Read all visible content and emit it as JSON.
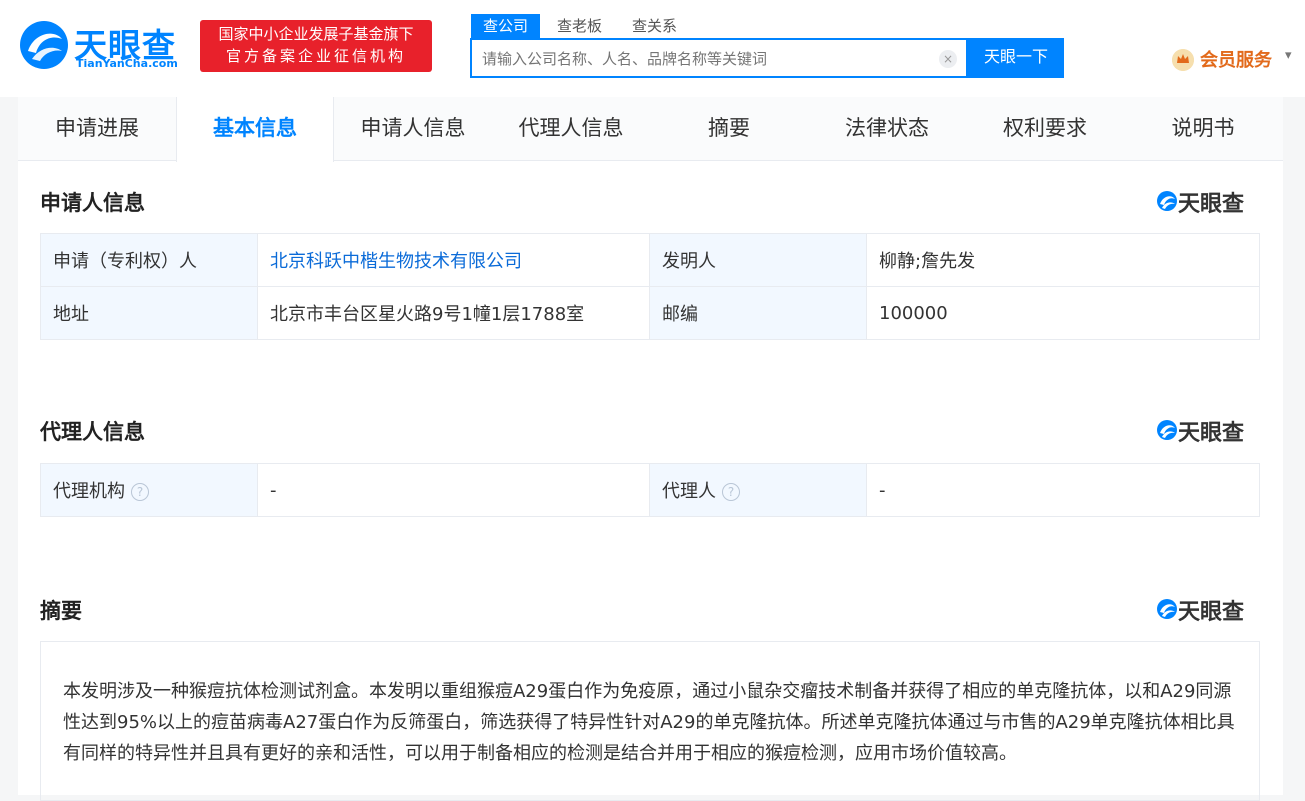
{
  "header": {
    "logo_text": "天眼查",
    "logo_sub": "TianYanCha.com",
    "badge_line1": "国家中小企业发展子基金旗下",
    "badge_line2": "官方备案企业征信机构",
    "search_tabs": [
      "查公司",
      "查老板",
      "查关系"
    ],
    "search_placeholder": "请输入公司名称、人名、品牌名称等关键词",
    "search_clear": "×",
    "search_button": "天眼一下",
    "member_label": "会员服务",
    "member_caret": "▾"
  },
  "tabs": [
    "申请进展",
    "基本信息",
    "申请人信息",
    "代理人信息",
    "摘要",
    "法律状态",
    "权利要求",
    "说明书"
  ],
  "active_tab": "基本信息",
  "watermark": "天眼查",
  "applicant_section": {
    "title": "申请人信息",
    "rows": [
      {
        "label1": "申请（专利权）人",
        "value1": "北京科跃中楷生物技术有限公司",
        "label2": "发明人",
        "value2": "柳静;詹先发"
      },
      {
        "label1": "地址",
        "value1": "北京市丰台区星火路9号1幢1层1788室",
        "label2": "邮编",
        "value2": "100000"
      }
    ]
  },
  "agent_section": {
    "title": "代理人信息",
    "label1": "代理机构",
    "value1": "-",
    "label2": "代理人",
    "value2": "-",
    "help_glyph": "?"
  },
  "abstract_section": {
    "title": "摘要",
    "text": "本发明涉及一种猴痘抗体检测试剂盒。本发明以重组猴痘A29蛋白作为免疫原，通过小鼠杂交瘤技术制备并获得了相应的单克隆抗体，以和A29同源性达到95%以上的痘苗病毒A27蛋白作为反筛蛋白，筛选获得了特异性针对A29的单克隆抗体。所述单克隆抗体通过与市售的A29单克隆抗体相比具有同样的特异性并且具有更好的亲和活性，可以用于制备相应的检测是结合并用于相应的猴痘检测，应用市场价值较高。"
  },
  "colors": {
    "brand_blue": "#0084ff",
    "badge_red": "#e8212b",
    "member_orange": "#e26a1b",
    "link_blue": "#0b6bd8",
    "label_bg": "#f2f8ff"
  }
}
